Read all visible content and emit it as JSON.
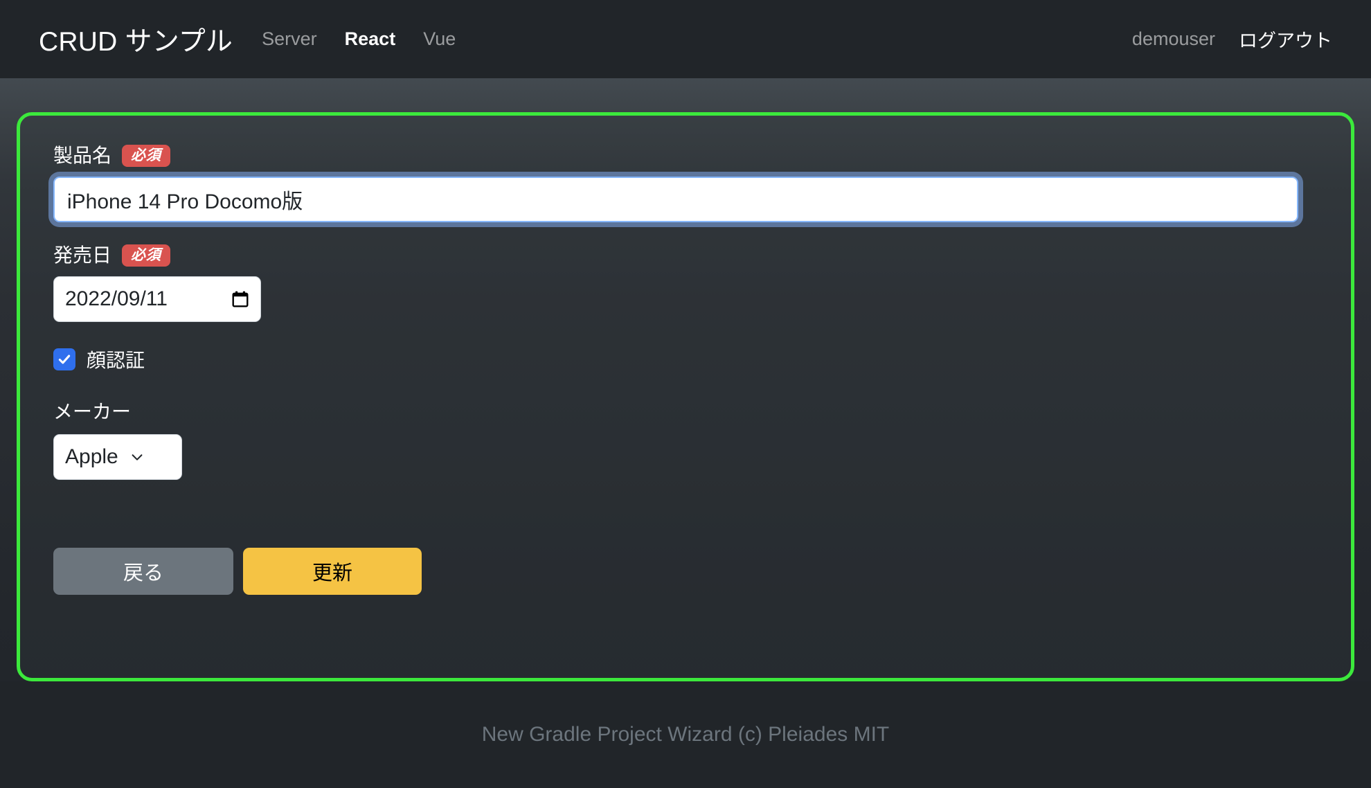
{
  "navbar": {
    "brand": "CRUD サンプル",
    "links": [
      {
        "label": "Server",
        "active": false
      },
      {
        "label": "React",
        "active": true
      },
      {
        "label": "Vue",
        "active": false
      }
    ],
    "user": "demouser",
    "logout": "ログアウト"
  },
  "form": {
    "product_name": {
      "label": "製品名",
      "required_badge": "必須",
      "value": "iPhone 14 Pro Docomo版",
      "placeholder": ""
    },
    "release_date": {
      "label": "発売日",
      "required_badge": "必須",
      "value": "2022/09/11"
    },
    "face_auth": {
      "label": "顔認証",
      "checked": true
    },
    "maker": {
      "label": "メーカー",
      "selected": "Apple"
    },
    "buttons": {
      "back": "戻る",
      "update": "更新"
    }
  },
  "footer": {
    "text": "New Gradle Project Wizard (c) Pleiades MIT"
  },
  "colors": {
    "navbar_bg": "#212529",
    "highlight_border": "#3ce93c",
    "required_badge": "#d9534f",
    "checkbox_on": "#2f6fed",
    "btn_back": "#6c757d",
    "btn_update": "#f5c344",
    "focus_ring": "#6e8fc4",
    "footer_text": "#6c757d"
  }
}
